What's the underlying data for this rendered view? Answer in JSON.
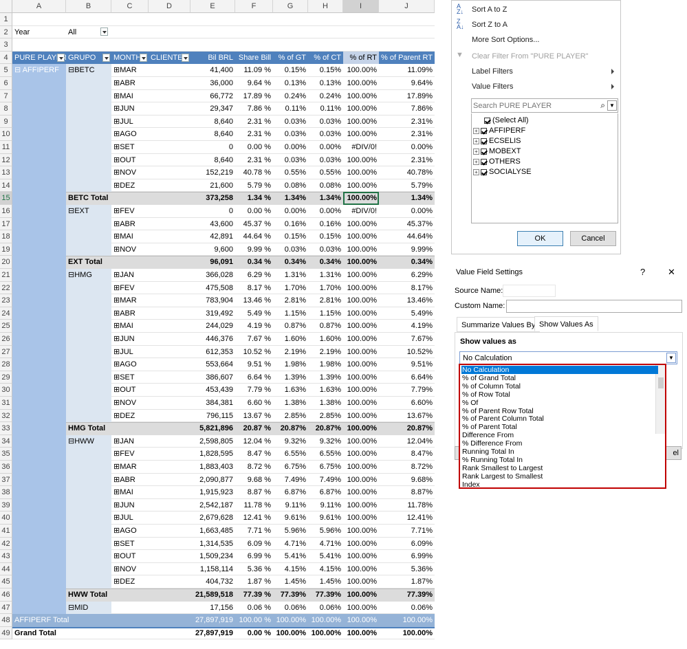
{
  "columns": [
    "A",
    "B",
    "C",
    "D",
    "E",
    "F",
    "G",
    "H",
    "I",
    "J"
  ],
  "rows": [
    "1",
    "2",
    "3",
    "4",
    "5",
    "6",
    "7",
    "8",
    "9",
    "10",
    "11",
    "12",
    "13",
    "14",
    "15",
    "16",
    "17",
    "18",
    "19",
    "20",
    "21",
    "22",
    "23",
    "24",
    "25",
    "26",
    "27",
    "28",
    "29",
    "30",
    "31",
    "32",
    "33",
    "34",
    "35",
    "36",
    "37",
    "38",
    "39",
    "40",
    "41",
    "42",
    "43",
    "44",
    "45",
    "46",
    "47",
    "48",
    "49"
  ],
  "filter": {
    "label": "Year",
    "value": "All"
  },
  "headers": [
    "PURE PLAYER",
    "GRUPO",
    "MONTH",
    "CLIENTE",
    "Bil BRL",
    "Share Bill",
    "% of GT",
    "% of CT",
    "% of RT",
    "% of Parent RT"
  ],
  "pure_player": "AFFIPERF",
  "data_rows": [
    {
      "grp": "BETC",
      "m": "MAR",
      "e": "41,400",
      "f": "11.09 %",
      "g": "0.15%",
      "h": "0.15%",
      "i": "100.00%",
      "j": "11.09%"
    },
    {
      "grp": "",
      "m": "ABR",
      "e": "36,000",
      "f": "9.64 %",
      "g": "0.13%",
      "h": "0.13%",
      "i": "100.00%",
      "j": "9.64%"
    },
    {
      "grp": "",
      "m": "MAI",
      "e": "66,772",
      "f": "17.89 %",
      "g": "0.24%",
      "h": "0.24%",
      "i": "100.00%",
      "j": "17.89%"
    },
    {
      "grp": "",
      "m": "JUN",
      "e": "29,347",
      "f": "7.86 %",
      "g": "0.11%",
      "h": "0.11%",
      "i": "100.00%",
      "j": "7.86%"
    },
    {
      "grp": "",
      "m": "JUL",
      "e": "8,640",
      "f": "2.31 %",
      "g": "0.03%",
      "h": "0.03%",
      "i": "100.00%",
      "j": "2.31%"
    },
    {
      "grp": "",
      "m": "AGO",
      "e": "8,640",
      "f": "2.31 %",
      "g": "0.03%",
      "h": "0.03%",
      "i": "100.00%",
      "j": "2.31%"
    },
    {
      "grp": "",
      "m": "SET",
      "e": "0",
      "f": "0.00 %",
      "g": "0.00%",
      "h": "0.00%",
      "i": "#DIV/0!",
      "j": "0.00%"
    },
    {
      "grp": "",
      "m": "OUT",
      "e": "8,640",
      "f": "2.31 %",
      "g": "0.03%",
      "h": "0.03%",
      "i": "100.00%",
      "j": "2.31%"
    },
    {
      "grp": "",
      "m": "NOV",
      "e": "152,219",
      "f": "40.78 %",
      "g": "0.55%",
      "h": "0.55%",
      "i": "100.00%",
      "j": "40.78%"
    },
    {
      "grp": "",
      "m": "DEZ",
      "e": "21,600",
      "f": "5.79 %",
      "g": "0.08%",
      "h": "0.08%",
      "i": "100.00%",
      "j": "5.79%"
    },
    {
      "total": "BETC Total",
      "e": "373,258",
      "f": "1.34 %",
      "g": "1.34%",
      "h": "1.34%",
      "i": "100.00%",
      "j": "1.34%"
    },
    {
      "grp": "EXT",
      "m": "FEV",
      "e": "0",
      "f": "0.00 %",
      "g": "0.00%",
      "h": "0.00%",
      "i": "#DIV/0!",
      "j": "0.00%"
    },
    {
      "grp": "",
      "m": "ABR",
      "e": "43,600",
      "f": "45.37 %",
      "g": "0.16%",
      "h": "0.16%",
      "i": "100.00%",
      "j": "45.37%"
    },
    {
      "grp": "",
      "m": "MAI",
      "e": "42,891",
      "f": "44.64 %",
      "g": "0.15%",
      "h": "0.15%",
      "i": "100.00%",
      "j": "44.64%"
    },
    {
      "grp": "",
      "m": "NOV",
      "e": "9,600",
      "f": "9.99 %",
      "g": "0.03%",
      "h": "0.03%",
      "i": "100.00%",
      "j": "9.99%"
    },
    {
      "total": "EXT Total",
      "e": "96,091",
      "f": "0.34 %",
      "g": "0.34%",
      "h": "0.34%",
      "i": "100.00%",
      "j": "0.34%"
    },
    {
      "grp": "HMG",
      "m": "JAN",
      "e": "366,028",
      "f": "6.29 %",
      "g": "1.31%",
      "h": "1.31%",
      "i": "100.00%",
      "j": "6.29%"
    },
    {
      "grp": "",
      "m": "FEV",
      "e": "475,508",
      "f": "8.17 %",
      "g": "1.70%",
      "h": "1.70%",
      "i": "100.00%",
      "j": "8.17%"
    },
    {
      "grp": "",
      "m": "MAR",
      "e": "783,904",
      "f": "13.46 %",
      "g": "2.81%",
      "h": "2.81%",
      "i": "100.00%",
      "j": "13.46%"
    },
    {
      "grp": "",
      "m": "ABR",
      "e": "319,492",
      "f": "5.49 %",
      "g": "1.15%",
      "h": "1.15%",
      "i": "100.00%",
      "j": "5.49%"
    },
    {
      "grp": "",
      "m": "MAI",
      "e": "244,029",
      "f": "4.19 %",
      "g": "0.87%",
      "h": "0.87%",
      "i": "100.00%",
      "j": "4.19%"
    },
    {
      "grp": "",
      "m": "JUN",
      "e": "446,376",
      "f": "7.67 %",
      "g": "1.60%",
      "h": "1.60%",
      "i": "100.00%",
      "j": "7.67%"
    },
    {
      "grp": "",
      "m": "JUL",
      "e": "612,353",
      "f": "10.52 %",
      "g": "2.19%",
      "h": "2.19%",
      "i": "100.00%",
      "j": "10.52%"
    },
    {
      "grp": "",
      "m": "AGO",
      "e": "553,664",
      "f": "9.51 %",
      "g": "1.98%",
      "h": "1.98%",
      "i": "100.00%",
      "j": "9.51%"
    },
    {
      "grp": "",
      "m": "SET",
      "e": "386,607",
      "f": "6.64 %",
      "g": "1.39%",
      "h": "1.39%",
      "i": "100.00%",
      "j": "6.64%"
    },
    {
      "grp": "",
      "m": "OUT",
      "e": "453,439",
      "f": "7.79 %",
      "g": "1.63%",
      "h": "1.63%",
      "i": "100.00%",
      "j": "7.79%"
    },
    {
      "grp": "",
      "m": "NOV",
      "e": "384,381",
      "f": "6.60 %",
      "g": "1.38%",
      "h": "1.38%",
      "i": "100.00%",
      "j": "6.60%"
    },
    {
      "grp": "",
      "m": "DEZ",
      "e": "796,115",
      "f": "13.67 %",
      "g": "2.85%",
      "h": "2.85%",
      "i": "100.00%",
      "j": "13.67%"
    },
    {
      "total": "HMG Total",
      "e": "5,821,896",
      "f": "20.87 %",
      "g": "20.87%",
      "h": "20.87%",
      "i": "100.00%",
      "j": "20.87%"
    },
    {
      "grp": "HWW",
      "m": "JAN",
      "e": "2,598,805",
      "f": "12.04 %",
      "g": "9.32%",
      "h": "9.32%",
      "i": "100.00%",
      "j": "12.04%"
    },
    {
      "grp": "",
      "m": "FEV",
      "e": "1,828,595",
      "f": "8.47 %",
      "g": "6.55%",
      "h": "6.55%",
      "i": "100.00%",
      "j": "8.47%"
    },
    {
      "grp": "",
      "m": "MAR",
      "e": "1,883,403",
      "f": "8.72 %",
      "g": "6.75%",
      "h": "6.75%",
      "i": "100.00%",
      "j": "8.72%"
    },
    {
      "grp": "",
      "m": "ABR",
      "e": "2,090,877",
      "f": "9.68 %",
      "g": "7.49%",
      "h": "7.49%",
      "i": "100.00%",
      "j": "9.68%"
    },
    {
      "grp": "",
      "m": "MAI",
      "e": "1,915,923",
      "f": "8.87 %",
      "g": "6.87%",
      "h": "6.87%",
      "i": "100.00%",
      "j": "8.87%"
    },
    {
      "grp": "",
      "m": "JUN",
      "e": "2,542,187",
      "f": "11.78 %",
      "g": "9.11%",
      "h": "9.11%",
      "i": "100.00%",
      "j": "11.78%"
    },
    {
      "grp": "",
      "m": "JUL",
      "e": "2,679,628",
      "f": "12.41 %",
      "g": "9.61%",
      "h": "9.61%",
      "i": "100.00%",
      "j": "12.41%"
    },
    {
      "grp": "",
      "m": "AGO",
      "e": "1,663,485",
      "f": "7.71 %",
      "g": "5.96%",
      "h": "5.96%",
      "i": "100.00%",
      "j": "7.71%"
    },
    {
      "grp": "",
      "m": "SET",
      "e": "1,314,535",
      "f": "6.09 %",
      "g": "4.71%",
      "h": "4.71%",
      "i": "100.00%",
      "j": "6.09%"
    },
    {
      "grp": "",
      "m": "OUT",
      "e": "1,509,234",
      "f": "6.99 %",
      "g": "5.41%",
      "h": "5.41%",
      "i": "100.00%",
      "j": "6.99%"
    },
    {
      "grp": "",
      "m": "NOV",
      "e": "1,158,114",
      "f": "5.36 %",
      "g": "4.15%",
      "h": "4.15%",
      "i": "100.00%",
      "j": "5.36%"
    },
    {
      "grp": "",
      "m": "DEZ",
      "e": "404,732",
      "f": "1.87 %",
      "g": "1.45%",
      "h": "1.45%",
      "i": "100.00%",
      "j": "1.87%"
    },
    {
      "total": "HWW Total",
      "e": "21,589,518",
      "f": "77.39 %",
      "g": "77.39%",
      "h": "77.39%",
      "i": "100.00%",
      "j": "77.39%"
    },
    {
      "grp": "MID",
      "m": "",
      "e": "17,156",
      "f": "0.06 %",
      "g": "0.06%",
      "h": "0.06%",
      "i": "100.00%",
      "j": "0.06%"
    }
  ],
  "pp_total": {
    "label": "AFFIPERF Total",
    "e": "27,897,919",
    "f": "100.00 %",
    "g": "100.00%",
    "h": "100.00%",
    "i": "100.00%",
    "j": "100.00%"
  },
  "grand_total": {
    "label": "Grand Total",
    "e": "27,897,919",
    "f": "0.00 %",
    "g": "100.00%",
    "h": "100.00%",
    "i": "100.00%",
    "j": "100.00%"
  },
  "sort_menu": {
    "sort_az": "Sort A to Z",
    "sort_za": "Sort Z to A",
    "more_sort": "More Sort Options...",
    "clear_filter": "Clear Filter From \"PURE PLAYER\"",
    "label_filters": "Label Filters",
    "value_filters": "Value Filters",
    "search_placeholder": "Search PURE PLAYER",
    "items": [
      "(Select All)",
      "AFFIPERF",
      "ECSELIS",
      "MOBEXT",
      "OTHERS",
      "SOCIALYSE"
    ],
    "ok": "OK",
    "cancel": "Cancel"
  },
  "vfs": {
    "title": "Value Field Settings",
    "help": "?",
    "close": "✕",
    "source_label": "Source Name:",
    "custom_label": "Custom Name:",
    "tab1": "Summarize Values By",
    "tab2": "Show Values As",
    "show_values_as": "Show values as",
    "selected": "No Calculation",
    "options": [
      "No Calculation",
      "% of Grand Total",
      "% of Column Total",
      "% of Row Total",
      "% Of",
      "% of Parent Row Total",
      "% of Parent Column Total",
      "% of Parent Total",
      "Difference From",
      "% Difference From",
      "Running Total In",
      "% Running Total In",
      "Rank Smallest to Largest",
      "Rank Largest to Smallest",
      "Index"
    ],
    "cancel_fragment": "el"
  },
  "colors": {
    "header": "#4f81bd",
    "pp_total": "#95b3d7",
    "highlight": "#c00000"
  }
}
